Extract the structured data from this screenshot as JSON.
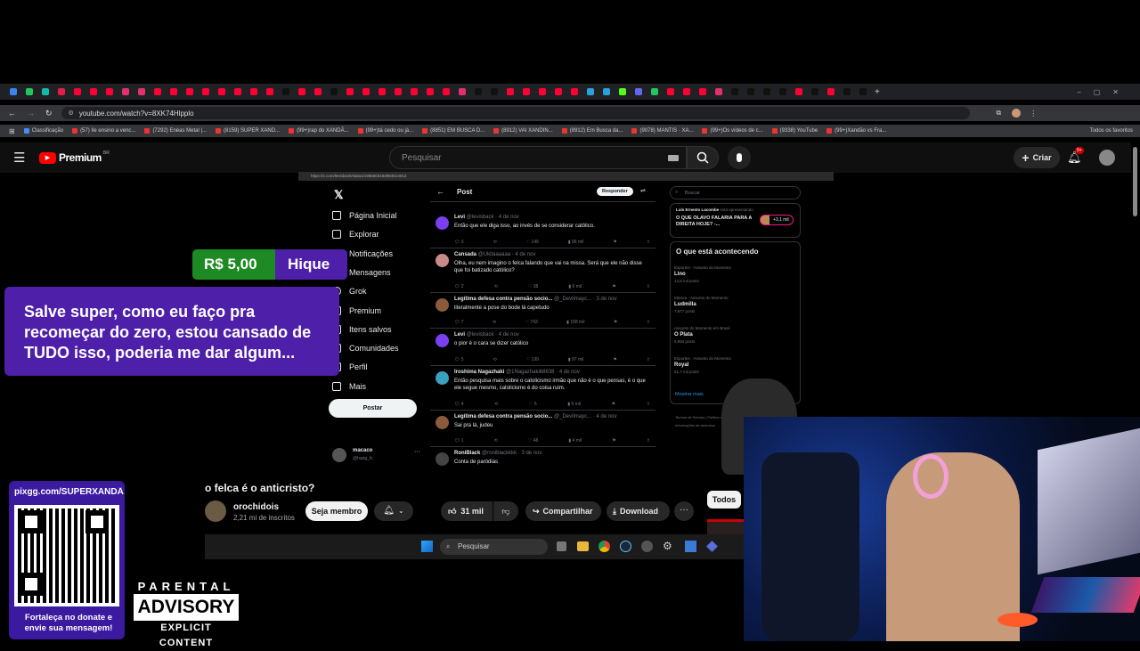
{
  "browser": {
    "url": "youtube.com/watch?v=8XK74Hlpplo",
    "bookmarks": [
      "Classificação",
      "(57) Ile ensino a venc...",
      "(7292) Enéas Metal |...",
      "(8159) SUPER XAND...",
      "(99+)rap do XANDÃ...",
      "(99+)tá cedo ou já...",
      "(8851) EM BUSCA D...",
      "(8912) VAI XANDIN...",
      "(8912) Em Busca da...",
      "(9078) MANTIS · XA...",
      "(99+)Os vídeos de c...",
      "(9338) YouTube",
      "(99+)Xandão vs Fra..."
    ],
    "all_favorites": "Todos os favoritos"
  },
  "youtube": {
    "logo": "Premium",
    "logo_region": "BR",
    "search_placeholder": "Pesquisar",
    "create_label": "Criar",
    "notif_badge": "9+",
    "video_title": "o felca é o anticristo?",
    "channel_name": "orochidois",
    "subscribers": "2,21 mi de inscritos",
    "member_label": "Seja membro",
    "likes": "31 mil",
    "share_label": "Compartilhar",
    "download_label": "Download",
    "filter_chip": "Todos"
  },
  "x_embed": {
    "url": "https://x.com/levisback/status/1955503162984514013",
    "nav": [
      "Página Inicial",
      "Explorar",
      "Notificações",
      "Mensagens",
      "Grok",
      "Premium",
      "Itens salvos",
      "Comunidades",
      "Perfil",
      "Mais"
    ],
    "post_button": "Postar",
    "account_name": "macaco",
    "account_handle": "@hang_fc",
    "page_title": "Post",
    "reply_button": "Responder",
    "search_placeholder": "Buscar",
    "spaces_host": "Luís Ernesto Lacombe",
    "spaces_suffix": "está apresentando",
    "spaces_title": "O QUE OLAVO FALARIA PARA A DIREITA HOJE? -...",
    "spaces_count": "+3,1 mil",
    "trending_header": "O que está acontecendo",
    "trends": [
      {
        "category": "Esportes · Assunto do Momento",
        "name": "Lino",
        "count": "14,8 mil posts"
      },
      {
        "category": "Música · Assunto do Momento",
        "name": "Ludmilla",
        "count": "7,677 posts"
      },
      {
        "category": "Assunto do Momento em Brasil",
        "name": "O Plata",
        "count": "5,994 posts"
      },
      {
        "category": "Esportes · Assunto do Momento",
        "name": "Royal",
        "count": "61,7 mil posts"
      }
    ],
    "show_more": "Mostrar mais",
    "footer": "Termos de Serviço | Política de cookies | Informações de anúncios",
    "posts": [
      {
        "name": "Levi",
        "handle": "@levisback · 4 de nov",
        "text": "Então que ele diga isso, ao invés de se considerar católico.",
        "replies": "3",
        "likes": "146",
        "views": "96 mil",
        "color": "#7b3ff2"
      },
      {
        "name": "Cansada",
        "handle": "@Ukitaaaaaa · 4 de nov",
        "text": "Olha, eu nem imagino o felca falando que vai na missa. Será que ele não disse que foi batizado católico?",
        "replies": "2",
        "likes": "38",
        "views": "6 mil",
        "color": "#c98a8a"
      },
      {
        "name": "Legítima defesa contra pensão socio...",
        "handle": "@_Devilmayc... · 3 de nov",
        "text": "literalmente a pose do bode lá capetudo",
        "replies": "7",
        "likes": "743",
        "views": "158 mil",
        "color": "#8a5a3a"
      },
      {
        "name": "Levi",
        "handle": "@levisback · 4 de nov",
        "text": "o pior é o cara se dizer católico",
        "replies": "5",
        "likes": "199",
        "views": "97 mil",
        "color": "#7b3ff2"
      },
      {
        "name": "Iroshima Nagazhaki",
        "handle": "@1Nagazhaki68638 · 4 de nov",
        "text": "Então pesquisa mais sobre o catolicismo irmão que não é o que pensas, é o que ele segue mesmo, catolicismo é do coisa ruim.",
        "replies": "4",
        "likes": "6",
        "views": "6 mil",
        "color": "#3aa0c0"
      },
      {
        "name": "Legítima defesa contra pensão socio...",
        "handle": "@_Devilmayc... · 4 de nov",
        "text": "Sai pra lá, judeu",
        "replies": "1",
        "likes": "48",
        "views": "4 mil",
        "color": "#8a5a3a"
      },
      {
        "name": "RoniBlack",
        "handle": "@roniblackkkk · 3 de nov",
        "text": "Conta de paródias",
        "replies": "",
        "likes": "",
        "views": "",
        "color": "#444"
      }
    ]
  },
  "overlays": {
    "superchat_amount": "R$ 5,00",
    "superchat_user": "Hique",
    "superchat_message": "Salve super, como eu faço pra recomeçar do zero, estou cansado de TUDO isso, poderia me dar algum...",
    "donate_url": "pixgg.com/SUPERXANDÃ",
    "donate_caption": "Fortaleça no donate e envie sua mensagem!",
    "parental_line1": "PARENTAL",
    "parental_line2": "ADVISORY",
    "parental_line3": "EXPLICIT CONTENT",
    "taskbar_search": "Pesquisar"
  }
}
